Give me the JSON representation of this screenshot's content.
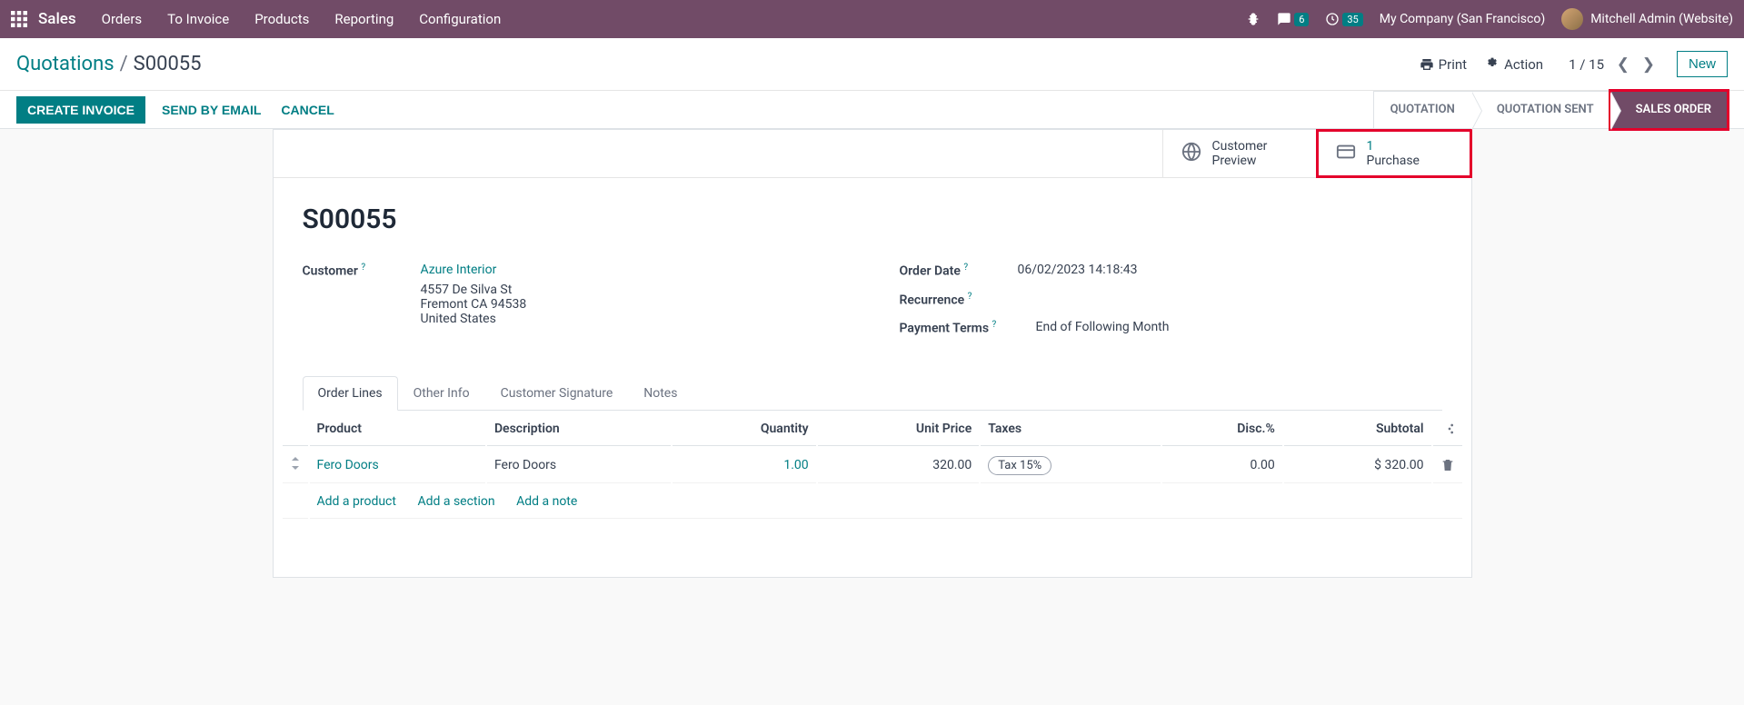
{
  "topnav": {
    "brand": "Sales",
    "menu": [
      "Orders",
      "To Invoice",
      "Products",
      "Reporting",
      "Configuration"
    ],
    "chat_badge": "6",
    "activity_badge": "35",
    "company": "My Company (San Francisco)",
    "user": "Mitchell Admin (Website)"
  },
  "breadcrumb": {
    "parent": "Quotations",
    "current": "S00055",
    "print": "Print",
    "action": "Action",
    "pager": "1 / 15",
    "new_btn": "New"
  },
  "actions": {
    "create_invoice": "CREATE INVOICE",
    "send_email": "SEND BY EMAIL",
    "cancel": "CANCEL"
  },
  "status": {
    "quotation": "QUOTATION",
    "quotation_sent": "QUOTATION SENT",
    "sales_order": "SALES ORDER"
  },
  "stats": {
    "customer_preview": "Customer",
    "customer_preview2": "Preview",
    "purchase_count": "1",
    "purchase_label": "Purchase"
  },
  "record": {
    "title": "S00055",
    "customer_label": "Customer",
    "customer_name": "Azure Interior",
    "addr1": "4557 De Silva St",
    "addr2": "Fremont CA 94538",
    "addr3": "United States",
    "order_date_label": "Order Date",
    "order_date": "06/02/2023 14:18:43",
    "recurrence_label": "Recurrence",
    "payment_terms_label": "Payment Terms",
    "payment_terms": "End of Following Month"
  },
  "tabs": [
    "Order Lines",
    "Other Info",
    "Customer Signature",
    "Notes"
  ],
  "table": {
    "headers": {
      "product": "Product",
      "description": "Description",
      "quantity": "Quantity",
      "unit_price": "Unit Price",
      "taxes": "Taxes",
      "disc": "Disc.%",
      "subtotal": "Subtotal"
    },
    "rows": [
      {
        "product": "Fero Doors",
        "description": "Fero Doors",
        "quantity": "1.00",
        "unit_price": "320.00",
        "tax": "Tax 15%",
        "disc": "0.00",
        "subtotal": "$ 320.00"
      }
    ],
    "add_product": "Add a product",
    "add_section": "Add a section",
    "add_note": "Add a note"
  }
}
